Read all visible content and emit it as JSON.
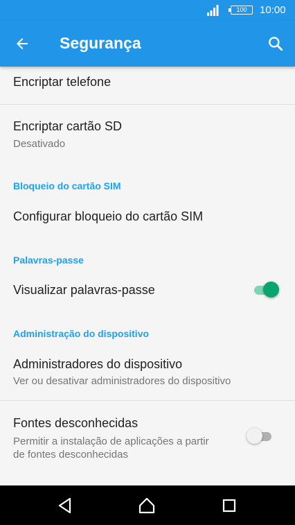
{
  "status_bar": {
    "battery": "100",
    "time": "10:00"
  },
  "toolbar": {
    "title": "Segurança",
    "back_icon": "arrow-back-icon",
    "search_icon": "search-icon"
  },
  "items": {
    "encrypt_phone": {
      "title": "Encriptar telefone"
    },
    "encrypt_sd": {
      "title": "Encriptar cartão SD",
      "summary": "Desativado"
    },
    "sim_lock": {
      "title": "Configurar bloqueio do cartão SIM"
    },
    "show_passwords": {
      "title": "Visualizar palavras-passe",
      "enabled": true
    },
    "device_admins": {
      "title": "Administradores do dispositivo",
      "summary": "Ver ou desativar administradores do dispositivo"
    },
    "unknown_sources": {
      "title": "Fontes desconhecidas",
      "summary_line1": "Permitir a instalação de aplicações a partir",
      "summary_line2": "de fontes desconhecidas",
      "enabled": false
    }
  },
  "categories": {
    "sim": "Bloqueio do cartão SIM",
    "passwords": "Palavras-passe",
    "admin": "Administração do dispositivo"
  },
  "nav_bar": {
    "back": "back-triangle-icon",
    "home": "home-icon",
    "recents": "recents-square-icon"
  },
  "colors": {
    "primary": "#2196e8",
    "accent": "#1ea1f0",
    "switch_on": "#0aa56f"
  }
}
